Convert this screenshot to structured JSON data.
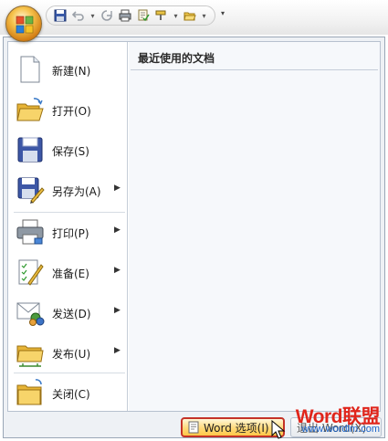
{
  "quick_access": {
    "icons": [
      "save-icon",
      "undo-icon",
      "redo-icon",
      "print-preview-icon",
      "spelling-icon",
      "format-painter-icon",
      "open-icon"
    ]
  },
  "commands": [
    {
      "label": "新建(N)",
      "icon": "new-document-icon",
      "has_submenu": false
    },
    {
      "label": "打开(O)",
      "icon": "open-folder-icon",
      "has_submenu": false
    },
    {
      "label": "保存(S)",
      "icon": "save-disk-icon",
      "has_submenu": false
    },
    {
      "label": "另存为(A)",
      "icon": "save-as-icon",
      "has_submenu": true
    },
    {
      "label": "打印(P)",
      "icon": "printer-icon",
      "has_submenu": true
    },
    {
      "label": "准备(E)",
      "icon": "prepare-icon",
      "has_submenu": true
    },
    {
      "label": "发送(D)",
      "icon": "send-icon",
      "has_submenu": true
    },
    {
      "label": "发布(U)",
      "icon": "publish-icon",
      "has_submenu": true
    },
    {
      "label": "关闭(C)",
      "icon": "close-folder-icon",
      "has_submenu": false
    }
  ],
  "recent": {
    "title": "最近使用的文档"
  },
  "footer": {
    "options_label": "Word 选项(I)",
    "exit_label": "退出 Word(X)"
  },
  "watermark": {
    "brand_w": "W",
    "brand_rest": "ord联盟",
    "url": "www.wordlm.com"
  },
  "colors": {
    "highlight_border": "#c43227",
    "highlight_fill": "#ffd97a",
    "panel_bg": "#f6f8fb",
    "brand_red": "#e0251b",
    "brand_blue": "#1a63c9"
  }
}
